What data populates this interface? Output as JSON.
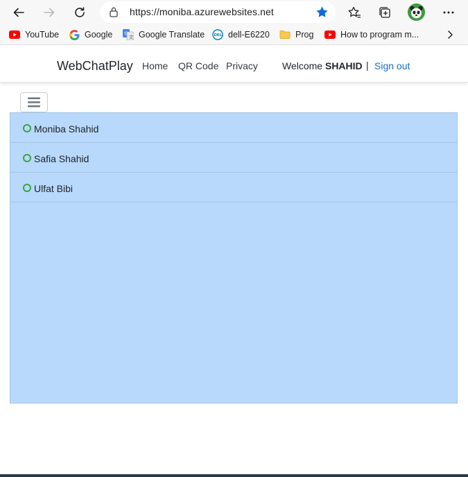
{
  "browser": {
    "url": "https://moniba.azurewebsites.net",
    "bookmarks": [
      {
        "label": "YouTube",
        "icon": "youtube-icon"
      },
      {
        "label": "Google",
        "icon": "google-icon"
      },
      {
        "label": "Google Translate",
        "icon": "google-translate-icon"
      },
      {
        "label": "dell-E6220",
        "icon": "dell-icon"
      },
      {
        "label": "Prog",
        "icon": "folder-icon"
      },
      {
        "label": "How to program m...",
        "icon": "youtube-icon"
      }
    ]
  },
  "navbar": {
    "brand": "WebChatPlay",
    "links": [
      "Home",
      "QR Code",
      "Privacy"
    ],
    "welcome_prefix": "Welcome",
    "user": "SHAHID",
    "separator": "|",
    "sign_out": "Sign out"
  },
  "contacts": [
    {
      "name": "Moniba Shahid"
    },
    {
      "name": "Safia Shahid"
    },
    {
      "name": "Ulfat Bibi"
    }
  ],
  "colors": {
    "panel_bg": "#b8d9fb",
    "online_status": "#3aa445",
    "link": "#1b6ec2",
    "star": "#0f6cd8"
  }
}
